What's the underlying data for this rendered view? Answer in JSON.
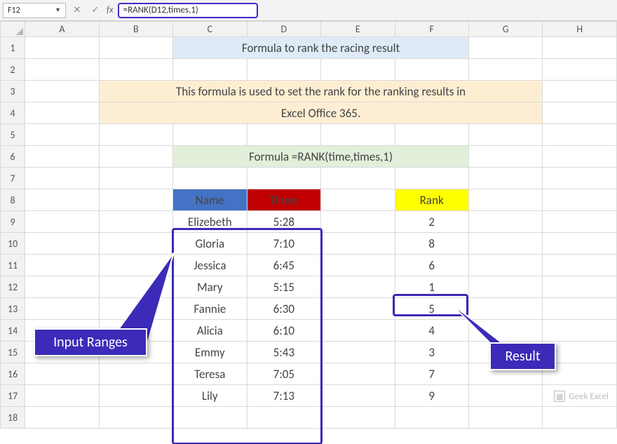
{
  "formula_bar": {
    "name_box": "F12",
    "fx_label": "fx",
    "formula": "=RANK(D12,times,1)"
  },
  "columns": [
    "A",
    "B",
    "C",
    "D",
    "E",
    "F",
    "G",
    "H"
  ],
  "rows": [
    "1",
    "2",
    "3",
    "4",
    "5",
    "6",
    "7",
    "8",
    "9",
    "10",
    "11",
    "12",
    "13",
    "14",
    "15",
    "16",
    "17",
    "18"
  ],
  "title": "Formula to rank the racing result",
  "description_line1": "This formula is used to set the rank for the ranking results in",
  "description_line2": "Excel Office 365.",
  "formula_text": "Formula =RANK(time,times,1)",
  "table_headers": {
    "name": "Name",
    "times": "Times",
    "rank": "Rank"
  },
  "chart_data": {
    "type": "table",
    "columns": [
      "Name",
      "Times",
      "Rank"
    ],
    "rows": [
      {
        "name": "Elizebeth",
        "times": "5:28",
        "rank": 2
      },
      {
        "name": "Gloria",
        "times": "7:10",
        "rank": 8
      },
      {
        "name": "Jessica",
        "times": "6:45",
        "rank": 6
      },
      {
        "name": "Mary",
        "times": "5:15",
        "rank": 1
      },
      {
        "name": "Fannie",
        "times": "6:30",
        "rank": 5
      },
      {
        "name": "Alicia",
        "times": "6:10",
        "rank": 4
      },
      {
        "name": "Emmy",
        "times": "5:43",
        "rank": 3
      },
      {
        "name": "Teresa",
        "times": "7:05",
        "rank": 7
      },
      {
        "name": "Lily",
        "times": "7:13",
        "rank": 9
      }
    ]
  },
  "callouts": {
    "input_ranges": "Input Ranges",
    "result": "Result"
  },
  "watermark": "Geek Excel",
  "colors": {
    "highlight_border": "#3b2bb8",
    "title_bg": "#deebf7",
    "desc_bg": "#fdeed3",
    "desc_text": "#c65911",
    "formula_bg": "#e2efda",
    "name_hdr_bg": "#4472c4",
    "times_hdr_bg": "#c00000",
    "rank_hdr_bg": "#ffff00"
  }
}
